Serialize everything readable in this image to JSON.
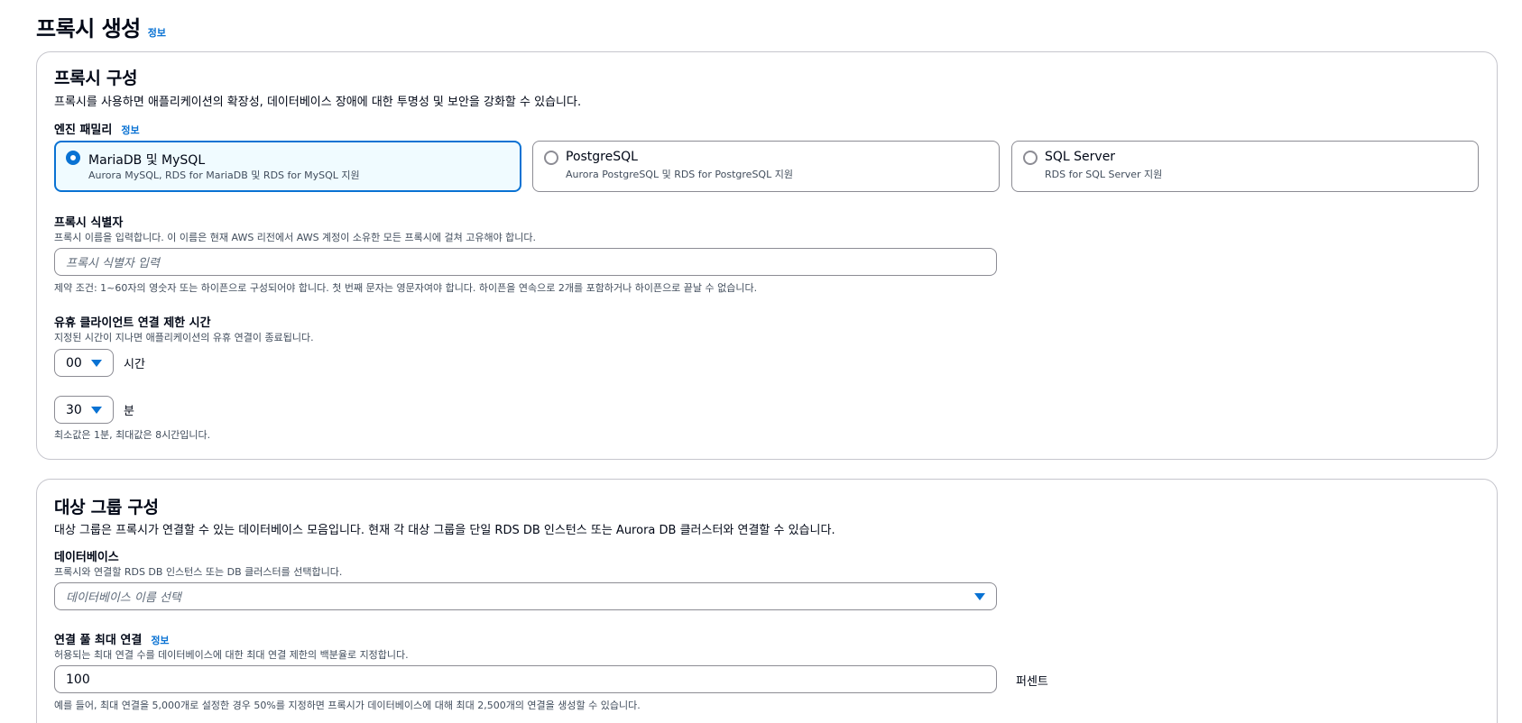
{
  "page": {
    "title": "프록시 생성",
    "info": "정보"
  },
  "proxy_config": {
    "title": "프록시 구성",
    "description": "프록시를 사용하면 애플리케이션의 확장성, 데이터베이스 장애에 대한 투명성 및 보안을 강화할 수 있습니다.",
    "engine_family": {
      "label": "엔진 패밀리",
      "info": "정보",
      "options": [
        {
          "title": "MariaDB 및 MySQL",
          "subtitle": "Aurora MySQL, RDS for MariaDB 및 RDS for MySQL 지원",
          "selected": true
        },
        {
          "title": "PostgreSQL",
          "subtitle": "Aurora PostgreSQL 및 RDS for PostgreSQL 지원",
          "selected": false
        },
        {
          "title": "SQL Server",
          "subtitle": "RDS for SQL Server 지원",
          "selected": false
        }
      ]
    },
    "identifier": {
      "label": "프록시 식별자",
      "description": "프록시 이름을 입력합니다. 이 이름은 현재 AWS 리전에서 AWS 계정이 소유한 모든 프록시에 걸쳐 고유해야 합니다.",
      "placeholder": "프록시 식별자 입력",
      "constraint": "제약 조건: 1~60자의 영숫자 또는 하이픈으로 구성되어야 합니다. 첫 번째 문자는 영문자여야 합니다. 하이픈을 연속으로 2개를 포함하거나 하이픈으로 끝날 수 없습니다."
    },
    "idle_timeout": {
      "label": "유휴 클라이언트 연결 제한 시간",
      "description": "지정된 시간이 지나면 애플리케이션의 유휴 연결이 종료됩니다.",
      "hours_value": "00",
      "hours_unit": "시간",
      "minutes_value": "30",
      "minutes_unit": "분",
      "hint": "최소값은 1분, 최대값은 8시간입니다."
    }
  },
  "target_group": {
    "title": "대상 그룹 구성",
    "description": "대상 그룹은 프록시가 연결할 수 있는 데이터베이스 모음입니다. 현재 각 대상 그룹을 단일 RDS DB 인스턴스 또는 Aurora DB 클러스터와 연결할 수 있습니다.",
    "database": {
      "label": "데이터베이스",
      "description": "프록시와 연결할 RDS DB 인스턴스 또는 DB 클러스터를 선택합니다.",
      "placeholder": "데이터베이스 이름 선택"
    },
    "max_connections": {
      "label": "연결 풀 최대 연결",
      "info": "정보",
      "description": "허용되는 최대 연결 수를 데이터베이스에 대한 최대 연결 제한의 백분율로 지정합니다.",
      "value": "100",
      "unit": "퍼센트",
      "hint": "예를 들어, 최대 연결을 5,000개로 설정한 경우 50%를 지정하면 프록시가 데이터베이스에 대해 최대 2,500개의 연결을 생성할 수 있습니다."
    }
  },
  "colors": {
    "accent": "#0972d3",
    "border": "#8c8c94",
    "selected_bg": "#f0fbff"
  },
  "icons": {
    "dropdown": "caret-down-icon",
    "radio": "radio-icon"
  }
}
